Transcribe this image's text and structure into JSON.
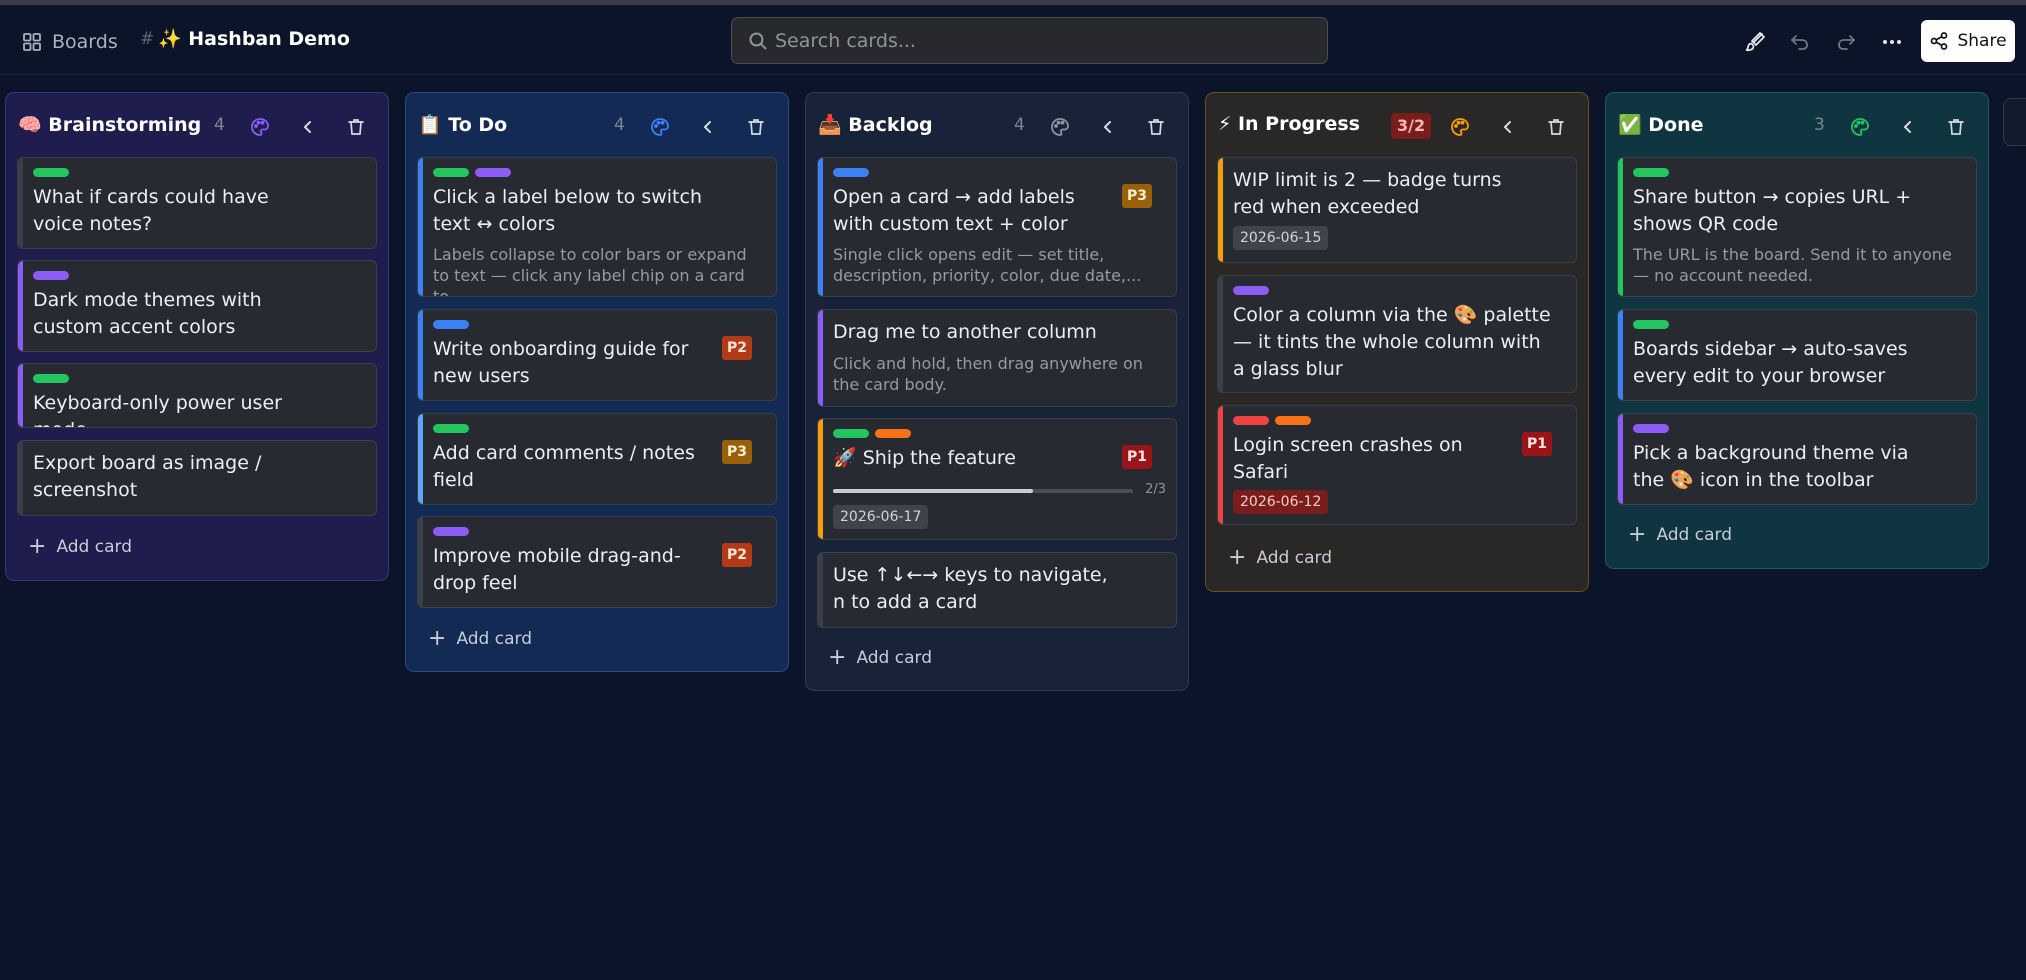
{
  "header": {
    "boards_label": "Boards",
    "separator": "#",
    "title": "✨ Hashban Demo",
    "search_placeholder": "Search cards...",
    "share_label": "Share"
  },
  "colors": {
    "green": "#22c55e",
    "purple": "#8b5cf6",
    "blue": "#3b82f6",
    "orange": "#f97316",
    "red": "#ef4444",
    "amber": "#f59e0b",
    "gray": "#3b3f47"
  },
  "columns": [
    {
      "title": "🧠 Brainstorming",
      "count": "4",
      "palette_color": "#8b5cf6",
      "add_label": "Add card",
      "cards": [
        {
          "title": "What if cards could have voice notes?",
          "labels": [
            "green"
          ]
        },
        {
          "title": "Dark mode themes with custom accent colors",
          "labels": [
            "purple"
          ]
        },
        {
          "title": "Keyboard-only power user mode",
          "labels": [
            "green"
          ]
        },
        {
          "title": "Export board as image / screenshot",
          "labels": []
        }
      ]
    },
    {
      "title": "📋 To Do",
      "count": "4",
      "palette_color": "#3b82f6",
      "add_label": "Add card",
      "cards": [
        {
          "title": "Click a label below to switch text ↔ colors",
          "labels": [
            "green",
            "purple"
          ],
          "description": "Labels collapse to color bars or expand to text — click any label chip on a card to..."
        },
        {
          "title": "Write onboarding guide for new users",
          "labels": [
            "blue"
          ],
          "priority": "P2"
        },
        {
          "title": "Add card comments / notes field",
          "labels": [
            "green"
          ],
          "priority": "P3"
        },
        {
          "title": "Improve mobile drag-and-drop feel",
          "labels": [
            "purple"
          ],
          "priority": "P2"
        }
      ]
    },
    {
      "title": "📥 Backlog",
      "count": "4",
      "palette_color": "#8e939c",
      "add_label": "Add card",
      "cards": [
        {
          "title": "Open a card → add labels with custom text + color",
          "labels": [
            "blue"
          ],
          "priority": "P3",
          "description": "Single click opens edit — set title, description, priority, color, due date,..."
        },
        {
          "title": "Drag me to another column",
          "labels": [],
          "description": "Click and hold, then drag anywhere on the card body."
        },
        {
          "title": "🚀 Ship the feature",
          "labels": [
            "green",
            "orange"
          ],
          "priority": "P1",
          "progress": "2/3",
          "progress_fraction": 0.667,
          "due": "2026-06-17"
        },
        {
          "title": "Use ↑↓←→ keys to navigate, n to add a card",
          "labels": []
        }
      ]
    },
    {
      "title": "⚡ In Progress",
      "wip": "3/2",
      "palette_color": "#f59e0b",
      "add_label": "Add card",
      "cards": [
        {
          "title": "WIP limit is 2 — badge turns red when exceeded",
          "labels": [],
          "due": "2026-06-15"
        },
        {
          "title": "Color a column via the 🎨 palette — it tints the whole column with a glass blur",
          "labels": [
            "purple"
          ]
        },
        {
          "title": "Login screen crashes on Safari",
          "labels": [
            "red",
            "orange"
          ],
          "priority": "P1",
          "due": "2026-06-12"
        }
      ]
    },
    {
      "title": "✅ Done",
      "count": "3",
      "palette_color": "#22c55e",
      "add_label": "Add card",
      "cards": [
        {
          "title": "Share button → copies URL + shows QR code",
          "labels": [
            "green"
          ],
          "description": "The URL is the board. Send it to anyone — no account needed."
        },
        {
          "title": "Boards sidebar → auto-saves every edit to your browser",
          "labels": [
            "green"
          ]
        },
        {
          "title": "Pick a background theme via the 🎨 icon in the toolbar",
          "labels": [
            "purple"
          ]
        }
      ]
    }
  ]
}
